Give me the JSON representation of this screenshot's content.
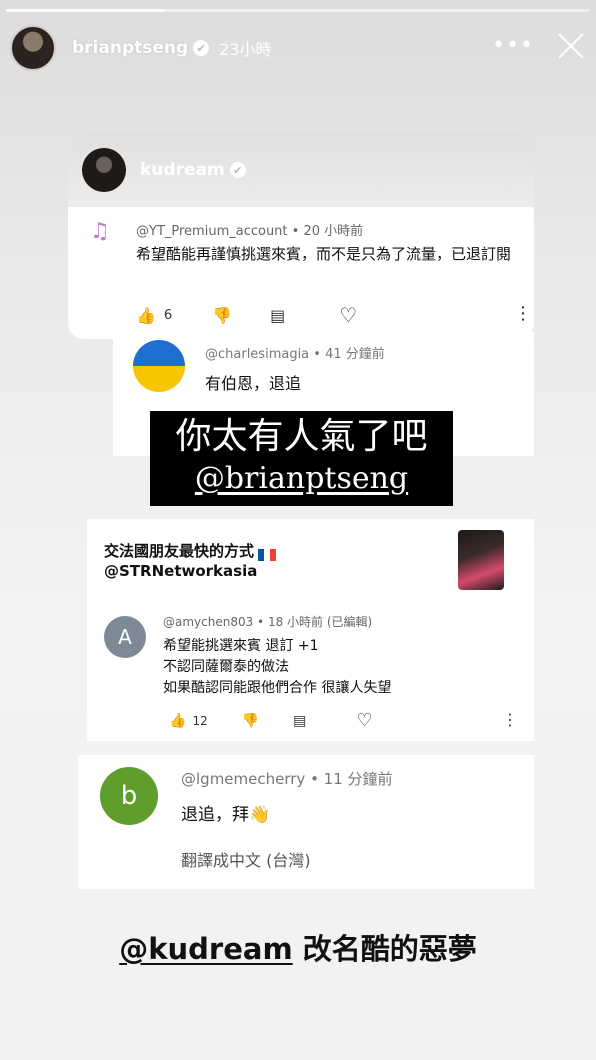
{
  "story": {
    "progress": 0.27,
    "username": "brianptseng",
    "verified_mark": "✔",
    "time": "23小時",
    "more_label": "•••",
    "icons": [
      "avatar",
      "verified-badge-icon",
      "more-icon",
      "close-icon"
    ]
  },
  "card1": {
    "account": "kudream",
    "comment": {
      "icon": "music-note-icon",
      "meta": "@YT_Premium_account • 20 小時前",
      "text": "希望酷能再謹慎挑選來賓，而不是只為了流量，已退訂閱",
      "likes": "6"
    }
  },
  "card2": {
    "meta": "@charlesimagia • 41 分鐘前",
    "text": "有伯恩，退追",
    "flag_colors": [
      "#1e6fd0",
      "#f7c600"
    ]
  },
  "sticker": {
    "line1": "你太有人氣了吧",
    "line2": "@brianptseng"
  },
  "card3": {
    "title_line1": "交法國朋友最快的方式",
    "title_line2": "@STRNetworkasia",
    "avatar_letter": "A",
    "meta": "@amychen803 • 18 小時前 (已編輯)",
    "lines": [
      "希望能挑選來賓 退訂 +1",
      "不認同薩爾泰的做法",
      "如果酷認同能跟他們合作 很讓人失望"
    ],
    "likes": "12"
  },
  "card4": {
    "avatar_letter": "b",
    "meta": "@lgmemecherry • 11 分鐘前",
    "text": "退追，拜👋",
    "translate": "翻譯成中文 (台灣)"
  },
  "caption": {
    "handle": "@kudream",
    "text": " 改名酷的惡夢"
  },
  "glyphs": {
    "like": "👍",
    "dislike": "👎",
    "reply": "▤",
    "heart": "♡",
    "kebab": "⋮"
  }
}
